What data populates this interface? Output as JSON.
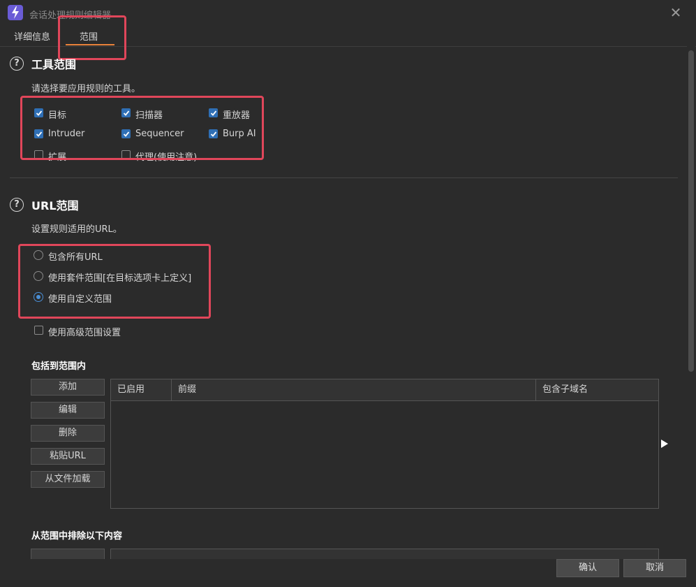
{
  "window": {
    "title": "会话处理规则编辑器",
    "close_glyph": "✕"
  },
  "tabs": [
    {
      "label": "详细信息",
      "selected": false
    },
    {
      "label": "范围",
      "selected": true
    }
  ],
  "tool_scope": {
    "help": "?",
    "title": "工具范围",
    "description": "请选择要应用规则的工具。",
    "tools": [
      {
        "label": "目标",
        "checked": true
      },
      {
        "label": "扫描器",
        "checked": true
      },
      {
        "label": "重放器",
        "checked": true
      },
      {
        "label": "Intruder",
        "checked": true
      },
      {
        "label": "Sequencer",
        "checked": true
      },
      {
        "label": "Burp AI",
        "checked": true
      },
      {
        "label": "扩展",
        "checked": false
      },
      {
        "label": "代理(使用注意)",
        "checked": false
      }
    ]
  },
  "url_scope": {
    "help": "?",
    "title": "URL范围",
    "description": "设置规则适用的URL。",
    "options": [
      {
        "label": "包含所有URL",
        "selected": false
      },
      {
        "label": "使用套件范围[在目标选项卡上定义]",
        "selected": false
      },
      {
        "label": "使用自定义范围",
        "selected": true
      }
    ],
    "advanced": {
      "label": "使用高级范围设置",
      "checked": false
    }
  },
  "include": {
    "title": "包括到范围内",
    "buttons": [
      "添加",
      "编辑",
      "删除",
      "粘贴URL",
      "从文件加载"
    ],
    "columns": [
      "已启用",
      "前缀",
      "包含子域名"
    ]
  },
  "exclude": {
    "title": "从范围中排除以下内容"
  },
  "footer": {
    "ok": "确认",
    "cancel": "取消"
  },
  "colors": {
    "background": "#2b2b2b",
    "accent_tab": "#e8823a",
    "checkbox": "#2f6fb5",
    "highlight": "#e0465a"
  }
}
